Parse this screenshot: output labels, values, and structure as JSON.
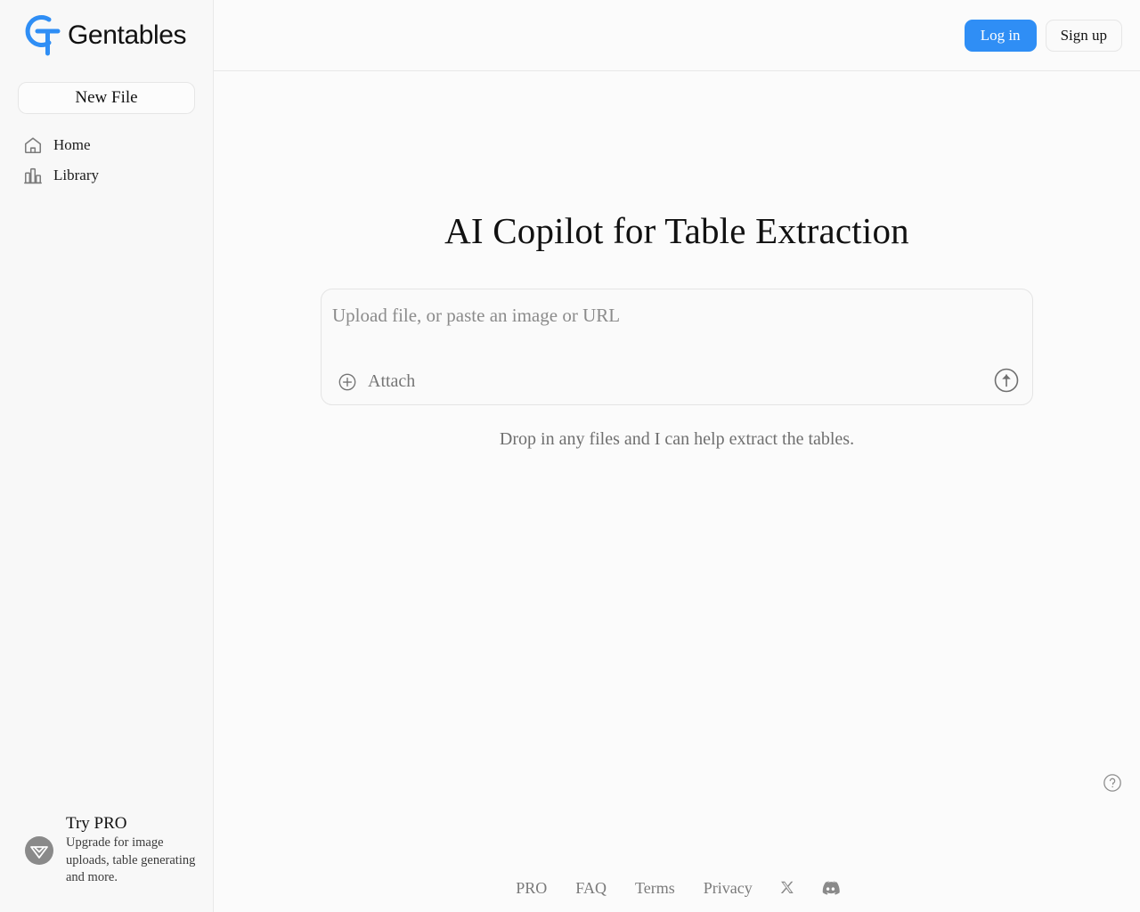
{
  "brand": {
    "name": "Gentables",
    "logo_icon": "gt-monogram-icon",
    "logo_color": "#2f8ef5"
  },
  "sidebar": {
    "new_file_label": "New File",
    "items": [
      {
        "label": "Home",
        "icon": "home-icon"
      },
      {
        "label": "Library",
        "icon": "library-bars-icon"
      }
    ],
    "pro_card": {
      "icon": "gem-badge-icon",
      "title": "Try PRO",
      "subtitle": "Upgrade for image uploads, table generating and more."
    }
  },
  "topbar": {
    "login_label": "Log in",
    "signup_label": "Sign up",
    "login_color": "#2f8ef5"
  },
  "main": {
    "title": "AI Copilot for Table Extraction",
    "composer": {
      "placeholder": "Upload file, or paste an image or URL",
      "value": "",
      "attach_label": "Attach",
      "attach_icon": "plus-circle-icon",
      "send_icon": "arrow-up-circle-icon"
    },
    "subtitle": "Drop in any files and I can help extract the tables."
  },
  "footer": {
    "links": [
      {
        "label": "PRO"
      },
      {
        "label": "FAQ"
      },
      {
        "label": "Terms"
      },
      {
        "label": "Privacy"
      }
    ],
    "socials": [
      {
        "name": "x-twitter-icon"
      },
      {
        "name": "discord-icon"
      }
    ]
  },
  "help": {
    "icon": "question-circle-icon"
  }
}
